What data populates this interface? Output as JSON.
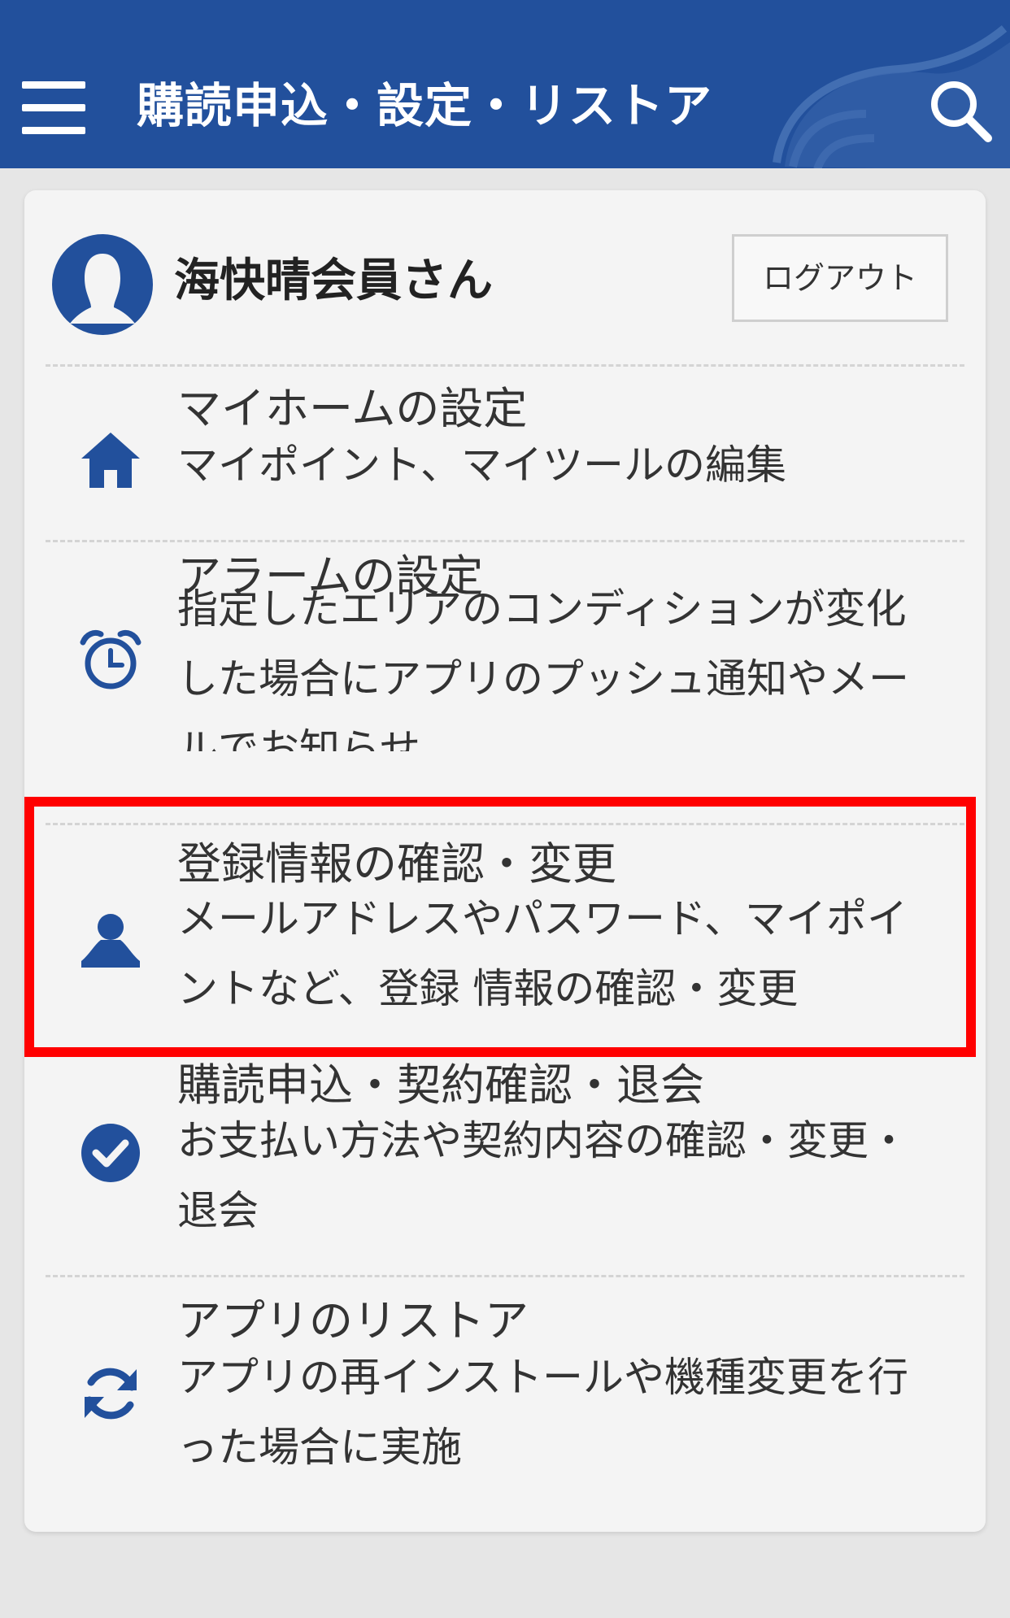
{
  "header": {
    "title": "購読申込・設定・リストア",
    "color": "#22509c"
  },
  "user": {
    "name": "海快晴会員さん",
    "logout_label": "ログアウト"
  },
  "menu": [
    {
      "icon": "home-icon",
      "title": "マイホームの設定",
      "desc": "マイポイント、マイツールの編集"
    },
    {
      "icon": "alarm-clock-icon",
      "title": "アラームの設定",
      "desc": "指定したエリアのコンディションが変化した場合にアプリのプッシュ通知やメールでお知らせ"
    },
    {
      "icon": "user-icon",
      "title": "登録情報の確認・変更",
      "desc": "メールアドレスやパスワード、マイポイントなど、登録 情報の確認・変更"
    },
    {
      "icon": "check-circle-icon",
      "title": "購読申込・契約確認・退会",
      "desc": "お支払い方法や契約内容の確認・変更・退会"
    },
    {
      "icon": "refresh-icon",
      "title": "アプリのリストア",
      "desc": "アプリの再インストールや機種変更を行った場合に実施"
    }
  ],
  "accent_color": "#22509c",
  "highlight_color": "#ff0000"
}
